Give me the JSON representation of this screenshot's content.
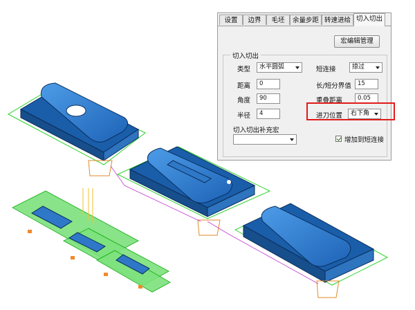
{
  "tabs": [
    {
      "label": "设置"
    },
    {
      "label": "边界"
    },
    {
      "label": "毛坯"
    },
    {
      "label": "余量步距"
    },
    {
      "label": "转速进给"
    },
    {
      "label": "切入切出",
      "active": true
    }
  ],
  "macro_button": "宏编辑管理",
  "group": {
    "title": "切入切出",
    "type": {
      "label": "类型",
      "value": "水平圆弧"
    },
    "distance": {
      "label": "距离",
      "value": "0"
    },
    "angle": {
      "label": "角度",
      "value": "90"
    },
    "radius": {
      "label": "半径",
      "value": "4"
    },
    "short_link": {
      "label": "短连接",
      "value": "掠过"
    },
    "boundary": {
      "label": "长/短分界值",
      "value": "15"
    },
    "overlap": {
      "label": "重叠距离",
      "value": "0.05"
    },
    "entry_position": {
      "label": "进刀位置",
      "value": "右下角"
    },
    "macro": {
      "label": "切入切出补充宏",
      "value": ""
    },
    "add_short_link": {
      "label": "增加到短连接",
      "checked": true
    }
  },
  "colors": {
    "part_blue": "#2f78c8",
    "toolpath_green": "#26c626",
    "highlight_red": "#e11919"
  }
}
